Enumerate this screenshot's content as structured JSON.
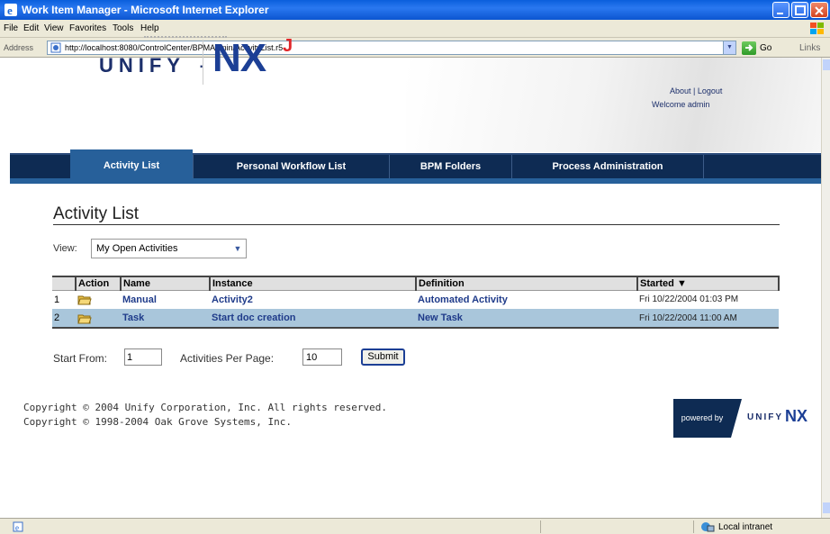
{
  "window": {
    "title": "Work Item Manager - Microsoft Internet Explorer"
  },
  "menu": [
    "File",
    "Edit",
    "View",
    "Favorites",
    "Tools",
    "Help"
  ],
  "address": {
    "label": "Address",
    "url": "http://localhost:8080/ControlCenter/BPMAdmin/ActivityList.r5",
    "go_label": "Go",
    "links_label": "Links"
  },
  "header": {
    "logo_unify": "UNIFY",
    "logo_dot": "·",
    "logo_nx": "NX",
    "logo_j": "J",
    "about": "About",
    "logout": "Logout",
    "link_separator": "|",
    "welcome": "Welcome admin"
  },
  "nav": {
    "tabs": [
      {
        "label": "Activity List",
        "active": true
      },
      {
        "label": "Personal Workflow List",
        "active": false
      },
      {
        "label": "BPM Folders",
        "active": false
      },
      {
        "label": "Process Administration",
        "active": false
      }
    ]
  },
  "main": {
    "title": "Activity List",
    "view_label": "View:",
    "view_value": "My Open Activities",
    "table": {
      "columns": [
        "",
        "Action",
        "Name",
        "Instance",
        "Definition",
        "Started ▼"
      ],
      "rows": [
        {
          "num": "1",
          "name": "Manual",
          "instance": "Activity2",
          "definition": "Automated Activity",
          "started": "Fri 10/22/2004 01:03 PM"
        },
        {
          "num": "2",
          "name": "Task",
          "instance": "Start doc creation",
          "definition": "New Task",
          "started": "Fri 10/22/2004 11:00 AM"
        }
      ]
    },
    "pager": {
      "start_from_label": "Start From:",
      "start_from_value": "1",
      "per_page_label": "Activities Per Page:",
      "per_page_value": "10",
      "submit_label": "Submit"
    }
  },
  "footer": {
    "copyright1": "Copyright © 2004 Unify Corporation, Inc. All rights reserved.",
    "copyright2": "Copyright © 1998-2004 Oak Grove Systems, Inc.",
    "powered_by": "powered by",
    "powered_unify": "UNIFY",
    "powered_nx": "NX"
  },
  "status": {
    "zone": "Local intranet"
  },
  "colors": {
    "nav_bg": "#0e2b53",
    "nav_active": "#27609a",
    "link": "#1f3b8a",
    "row_alt": "#a9c6db",
    "brand_red": "#e0262a"
  }
}
